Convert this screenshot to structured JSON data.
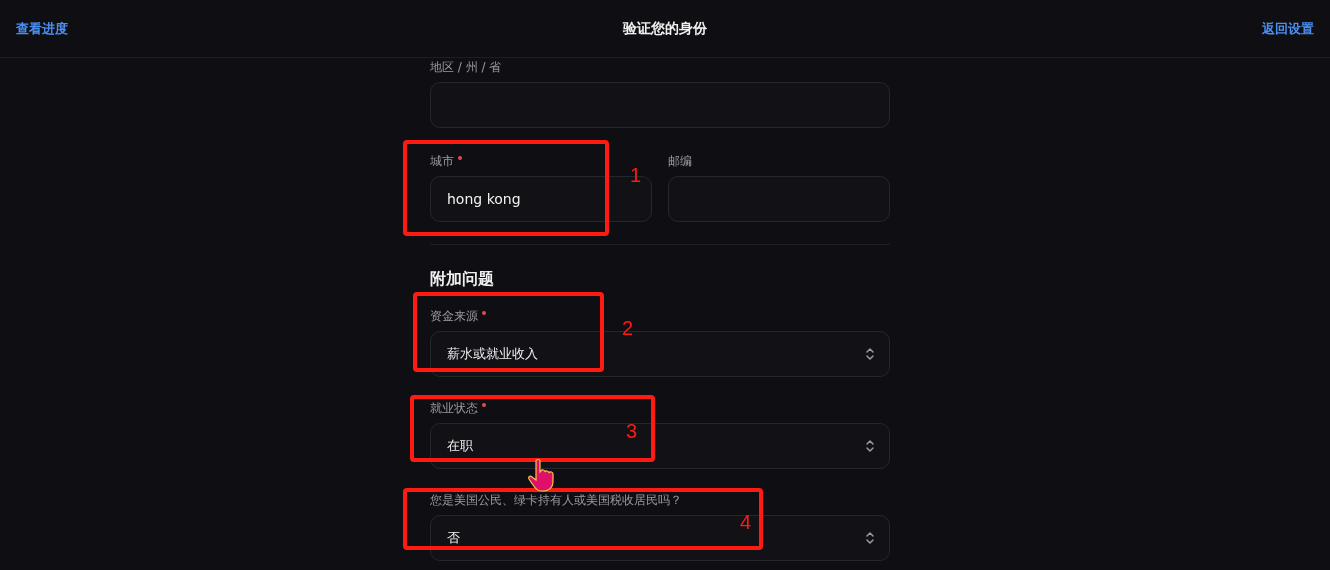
{
  "header": {
    "left_link": "查看进度",
    "title": "验证您的身份",
    "right_link": "返回设置"
  },
  "address": {
    "label": "地区 / 州 / 省",
    "required": false
  },
  "city": {
    "label": "城市",
    "value": "hong kong",
    "required": true,
    "callout": "1"
  },
  "zip": {
    "label": "邮编",
    "required": false
  },
  "section_title": "附加问题",
  "selects": [
    {
      "label": "资金来源",
      "value": "薪水或就业收入",
      "required": true,
      "callout": "2"
    },
    {
      "label": "就业状态",
      "value": "在职",
      "required": true,
      "callout": "3"
    },
    {
      "label": "您是美国公民、绿卡持有人或美国税收居民吗？",
      "value": "否",
      "required": false,
      "callout": "4"
    }
  ]
}
